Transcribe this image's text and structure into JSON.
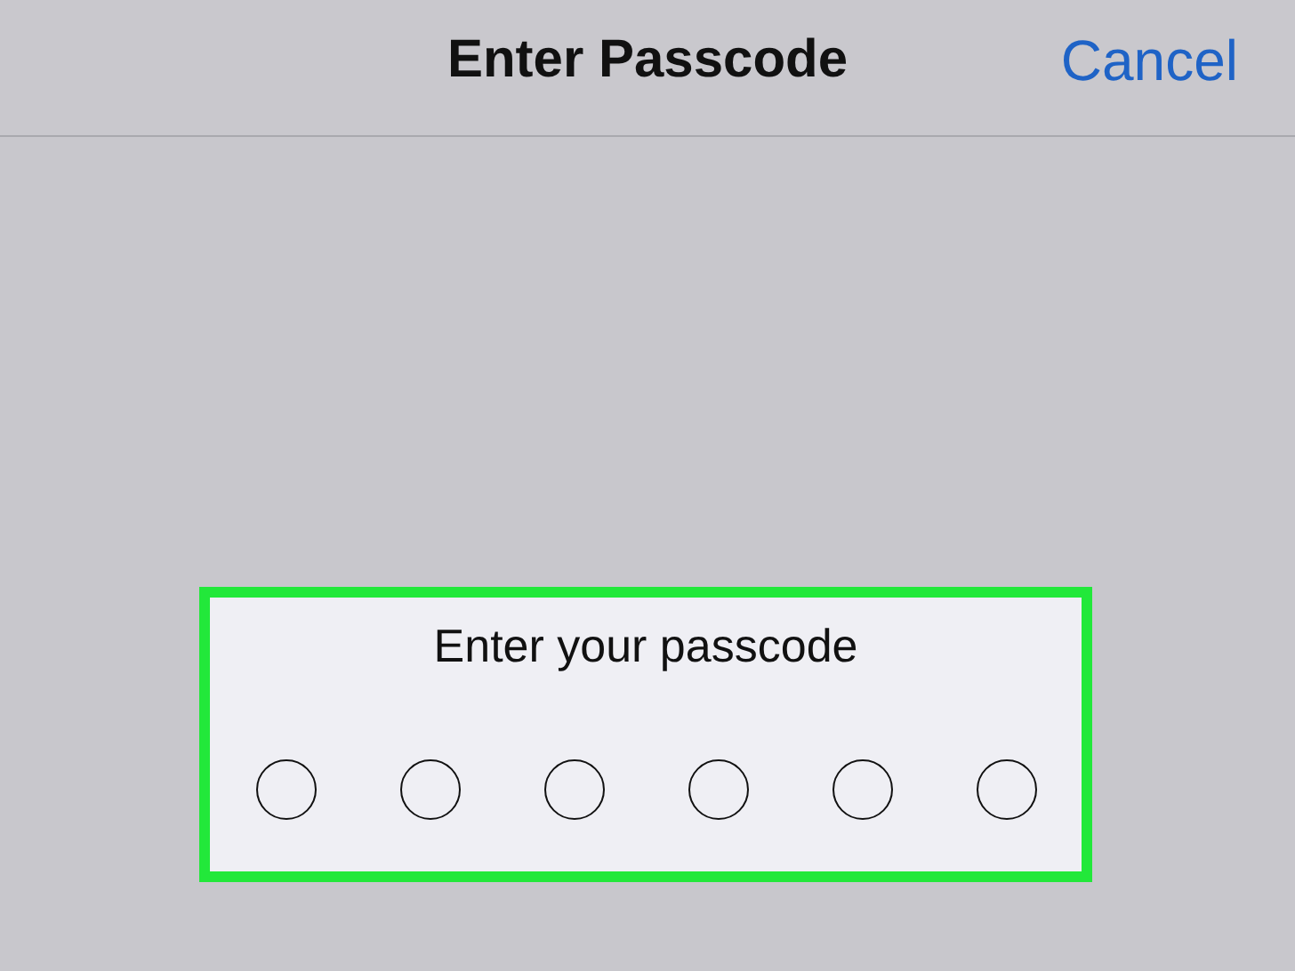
{
  "nav_bar": {
    "title": "Enter Passcode",
    "cancel": "Cancel"
  },
  "passcode_panel": {
    "highlighted": true,
    "prompt": "Enter your passcode",
    "dots": [
      {
        "filled": false
      },
      {
        "filled": false
      },
      {
        "filled": false
      },
      {
        "filled": false
      },
      {
        "filled": false
      },
      {
        "filled": false
      }
    ]
  }
}
